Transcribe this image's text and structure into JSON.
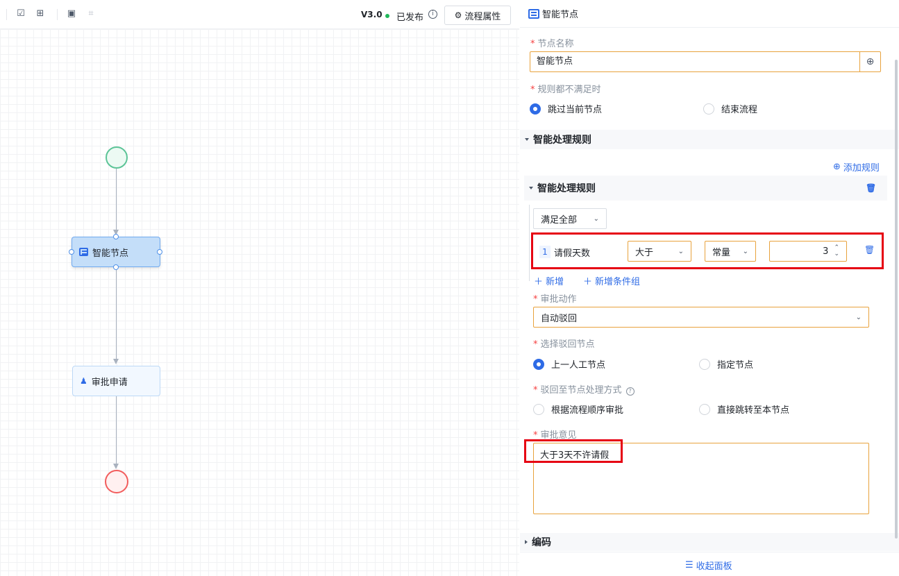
{
  "toolbar": {
    "version": "V3.0",
    "status": "已发布",
    "flow_props_label": "流程属性"
  },
  "flow": {
    "smart_node_label": "智能节点",
    "approval_node_label": "审批申请"
  },
  "panel": {
    "title": "智能节点",
    "node_name_label": "节点名称",
    "node_name_value": "智能节点",
    "rules_unmet_label": "规则都不满足时",
    "rules_unmet_options": [
      "跳过当前节点",
      "结束流程"
    ],
    "rules_unmet_selected": "跳过当前节点",
    "smart_rules_section": "智能处理规则",
    "add_rule_label": "添加规则",
    "rule_group_title": "智能处理规则",
    "match_mode": "满足全部",
    "condition": {
      "index": "1",
      "field": "请假天数",
      "operator": "大于",
      "value_type": "常量",
      "value": "3"
    },
    "add_label": "新增",
    "add_group_label": "新增条件组",
    "approval_action_label": "审批动作",
    "approval_action_value": "自动驳回",
    "reject_node_label": "选择驳回节点",
    "reject_node_options": [
      "上一人工节点",
      "指定节点"
    ],
    "reject_node_selected": "上一人工节点",
    "reject_mode_label": "驳回至节点处理方式",
    "reject_mode_options": [
      "根据流程顺序审批",
      "直接跳转至本节点"
    ],
    "comment_label": "审批意见",
    "comment_value": "大于3天不许请假",
    "code_section": "编码",
    "collapse_label": "收起面板"
  },
  "colors": {
    "accent": "#2e6be6",
    "highlight": "#e60012",
    "input_border": "#e8a23c",
    "start_node": "#5cc497",
    "end_node": "#f25c5c"
  }
}
